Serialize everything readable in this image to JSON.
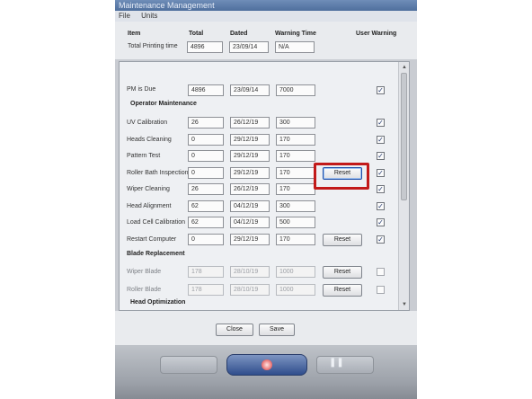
{
  "window": {
    "title": "Maintenance Management"
  },
  "menu": [
    "File",
    "Units"
  ],
  "columns": {
    "item": "Item",
    "total": "Total",
    "dated": "Dated",
    "warning_time": "Warning Time",
    "user_warning": "User Warning"
  },
  "total_printing": {
    "label": "Total Printing time",
    "total": "4896",
    "dated": "23/09/14",
    "warning": "N/A"
  },
  "pm_due": {
    "label": "PM is Due",
    "total": "4896",
    "dated": "23/09/14",
    "warning": "7000",
    "checked": true
  },
  "sections": {
    "operator": "Operator Maintenance",
    "blade": "Blade Replacement",
    "head_opt": "Head Optimization"
  },
  "operator_rows": [
    {
      "label": "UV Calibration",
      "total": "26",
      "dated": "26/12/19",
      "warning": "300",
      "checked": true,
      "reset": ""
    },
    {
      "label": "Heads Cleaning",
      "total": "0",
      "dated": "29/12/19",
      "warning": "170",
      "checked": true,
      "reset": ""
    },
    {
      "label": "Pattern Test",
      "total": "0",
      "dated": "29/12/19",
      "warning": "170",
      "checked": true,
      "reset": ""
    },
    {
      "label": "Roller Bath Inspection",
      "total": "0",
      "dated": "29/12/19",
      "warning": "170",
      "checked": true,
      "reset": "Reset"
    },
    {
      "label": "Wiper Cleaning",
      "total": "26",
      "dated": "26/12/19",
      "warning": "170",
      "checked": true,
      "reset": ""
    },
    {
      "label": "Head Alignment",
      "total": "62",
      "dated": "04/12/19",
      "warning": "300",
      "checked": true,
      "reset": ""
    },
    {
      "label": "Load Cell Calibration",
      "total": "62",
      "dated": "04/12/19",
      "warning": "500",
      "checked": true,
      "reset": ""
    },
    {
      "label": "Restart Computer",
      "total": "0",
      "dated": "29/12/19",
      "warning": "170",
      "checked": true,
      "reset": "Reset"
    }
  ],
  "blade_rows": [
    {
      "label": "Wiper Blade",
      "total": "178",
      "dated": "28/10/19",
      "warning": "1000",
      "checked": false,
      "reset": "Reset"
    },
    {
      "label": "Roller Blade",
      "total": "178",
      "dated": "28/10/19",
      "warning": "1000",
      "checked": false,
      "reset": "Reset"
    }
  ],
  "footer": {
    "close": "Close",
    "save": "Save"
  },
  "colors": {
    "highlight": "#c21a1a",
    "check": "#243a70"
  }
}
